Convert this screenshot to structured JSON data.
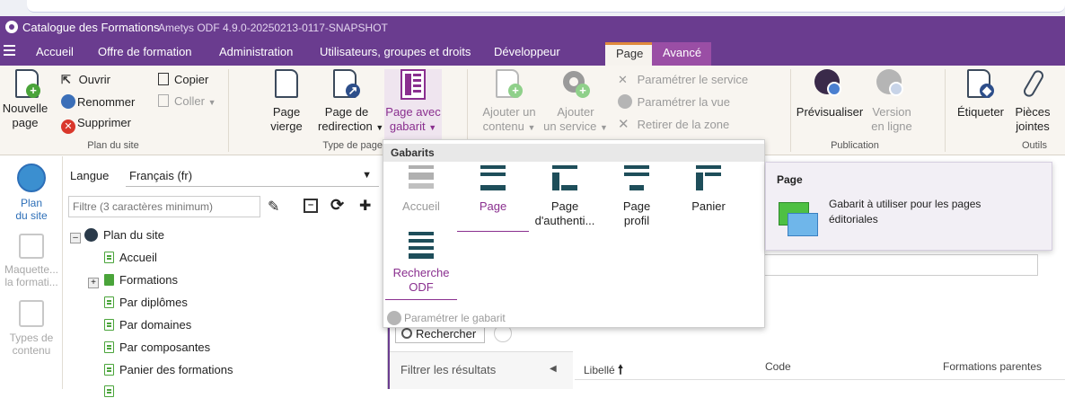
{
  "window": {
    "app_title": "Catalogue des Formations",
    "version": "Ametys ODF 4.9.0-20250213-0117-SNAPSHOT"
  },
  "menu": {
    "items": [
      "Accueil",
      "Offre de formation",
      "Administration",
      "Utilisateurs, groupes et droits",
      "Développeur"
    ],
    "context_tabs": [
      "Page",
      "Avancé"
    ]
  },
  "ribbon": {
    "plan": {
      "new_page": [
        "Nouvelle",
        "page"
      ],
      "open": "Ouvrir",
      "rename": "Renommer",
      "delete": "Supprimer",
      "copy": "Copier",
      "paste": "Coller",
      "group": "Plan du site"
    },
    "type": {
      "blank": [
        "Page",
        "vierge"
      ],
      "redirect": [
        "Page de",
        "redirection"
      ],
      "template": [
        "Page avec",
        "gabarit"
      ],
      "group": "Type de page"
    },
    "content": {
      "add_content": [
        "Ajouter un",
        "contenu"
      ],
      "add_service": [
        "Ajouter",
        "un service"
      ],
      "set_service": "Paramétrer le service",
      "set_view": "Paramétrer la vue",
      "remove_zone": "Retirer de la zone"
    },
    "publication": {
      "preview": "Prévisualiser",
      "online": [
        "Version",
        "en ligne"
      ],
      "group": "Publication"
    },
    "tools": {
      "tag": "Étiqueter",
      "attachments": [
        "Pièces",
        "jointes"
      ],
      "group": "Outils"
    }
  },
  "leftnav": {
    "items": [
      [
        "Plan",
        "du site"
      ],
      [
        "Maquette...",
        "la formati..."
      ],
      [
        "Types de",
        "contenu"
      ]
    ]
  },
  "tree": {
    "language_label": "Langue",
    "language_value": "Français (fr)",
    "filter_placeholder": "Filtre (3 caractères minimum)",
    "root": "Plan du site",
    "nodes": [
      "Accueil",
      "Formations",
      "Par diplômes",
      "Par domaines",
      "Par composantes",
      "Panier des formations"
    ]
  },
  "gabarits": {
    "title": "Gabarits",
    "items": [
      [
        "Accueil"
      ],
      [
        "Page"
      ],
      [
        "Page",
        "d'authenti..."
      ],
      [
        "Page",
        "profil"
      ],
      [
        "Panier"
      ],
      [
        "Recherche",
        "ODF"
      ]
    ],
    "footer": "Paramétrer le gabarit"
  },
  "tooltip": {
    "title": "Page",
    "text": [
      "Gabarit à utiliser pour les pages",
      "éditoriales"
    ]
  },
  "content": {
    "search_button": "Rechercher",
    "filter_label": "Filtrer les résultats",
    "columns": [
      "Libellé",
      "Code",
      "Formations parentes"
    ]
  },
  "colors": {
    "brand": "#6a3c8f",
    "accent": "#9a4ea5",
    "green": "#4aa43a"
  }
}
